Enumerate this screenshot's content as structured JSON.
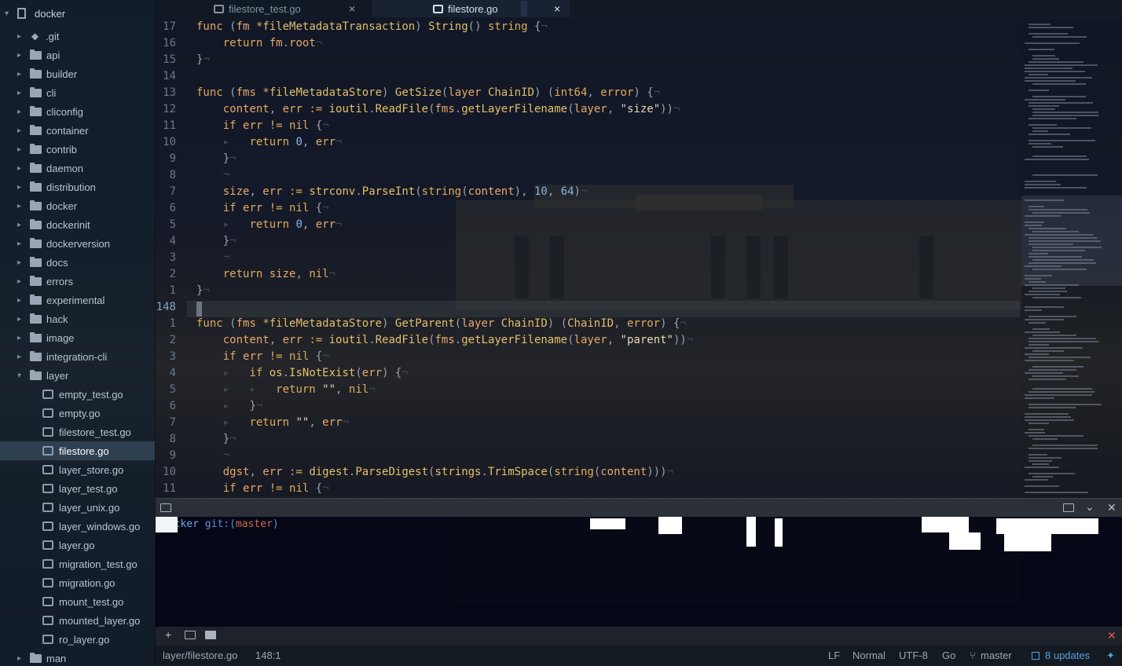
{
  "sidebar": {
    "root": "docker",
    "items": [
      {
        "label": ".git",
        "kind": "git"
      },
      {
        "label": "api",
        "kind": "folder"
      },
      {
        "label": "builder",
        "kind": "folder"
      },
      {
        "label": "cli",
        "kind": "folder"
      },
      {
        "label": "cliconfig",
        "kind": "folder"
      },
      {
        "label": "container",
        "kind": "folder"
      },
      {
        "label": "contrib",
        "kind": "folder"
      },
      {
        "label": "daemon",
        "kind": "folder"
      },
      {
        "label": "distribution",
        "kind": "folder"
      },
      {
        "label": "docker",
        "kind": "folder"
      },
      {
        "label": "dockerinit",
        "kind": "folder"
      },
      {
        "label": "dockerversion",
        "kind": "folder"
      },
      {
        "label": "docs",
        "kind": "folder"
      },
      {
        "label": "errors",
        "kind": "folder"
      },
      {
        "label": "experimental",
        "kind": "folder"
      },
      {
        "label": "hack",
        "kind": "folder"
      },
      {
        "label": "image",
        "kind": "folder"
      },
      {
        "label": "integration-cli",
        "kind": "folder"
      },
      {
        "label": "layer",
        "kind": "folder-open"
      },
      {
        "label": "empty_test.go",
        "kind": "file"
      },
      {
        "label": "empty.go",
        "kind": "file"
      },
      {
        "label": "filestore_test.go",
        "kind": "file"
      },
      {
        "label": "filestore.go",
        "kind": "file-selected"
      },
      {
        "label": "layer_store.go",
        "kind": "file"
      },
      {
        "label": "layer_test.go",
        "kind": "file"
      },
      {
        "label": "layer_unix.go",
        "kind": "file"
      },
      {
        "label": "layer_windows.go",
        "kind": "file"
      },
      {
        "label": "layer.go",
        "kind": "file"
      },
      {
        "label": "migration_test.go",
        "kind": "file"
      },
      {
        "label": "migration.go",
        "kind": "file"
      },
      {
        "label": "mount_test.go",
        "kind": "file"
      },
      {
        "label": "mounted_layer.go",
        "kind": "file"
      },
      {
        "label": "ro_layer.go",
        "kind": "file"
      },
      {
        "label": "man",
        "kind": "folder"
      }
    ]
  },
  "tabs": {
    "inactive": "filestore_test.go",
    "active": "filestore.go",
    "close_glyph": "×"
  },
  "editor": {
    "line_numbers": [
      "17",
      "16",
      "15",
      "14",
      "13",
      "12",
      "11",
      "10",
      "9",
      "8",
      "7",
      "6",
      "5",
      "4",
      "3",
      "2",
      "1",
      "148",
      "1",
      "2",
      "3",
      "4",
      "5",
      "6",
      "7",
      "8",
      "9",
      "10",
      "11"
    ],
    "current_line_index": 17
  },
  "terminal": {
    "cwd": "docker",
    "git_label": "git:(",
    "branch": "master",
    "git_close": ")"
  },
  "status": {
    "path": "layer/filestore.go",
    "position": "148:1",
    "eol": "LF",
    "mode": "Normal",
    "encoding": "UTF-8",
    "grammar": "Go",
    "branch": "master",
    "updates": "8 updates"
  },
  "icons": {
    "terminal_add": "+",
    "terminal_close": "✕"
  },
  "colors": {
    "keyword": "#e0ab5a",
    "number": "#8cb3e0",
    "update_accent": "#5aa0e0",
    "terminal_branch": "#d06a4a"
  }
}
